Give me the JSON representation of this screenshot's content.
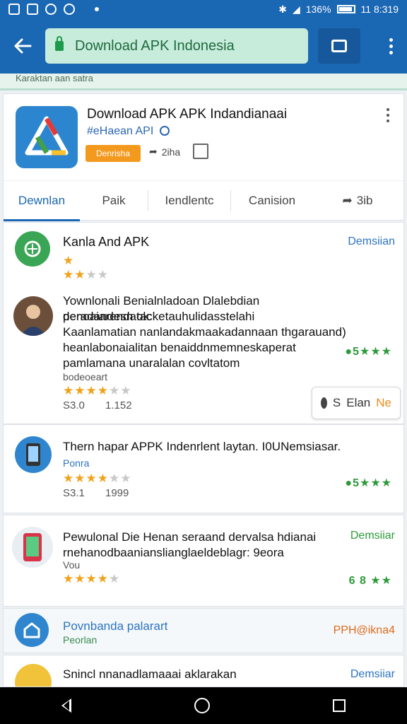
{
  "status_bar": {
    "battery_text": "136%",
    "time": "11 8:319",
    "icons": [
      "image-icon",
      "location-icon",
      "gallery-icon",
      "circle-icon",
      "bluetooth-icon",
      "wifi-off-icon",
      "battery-icon"
    ]
  },
  "toolbar": {
    "url": "Download APK Indonesia",
    "icons": [
      "back-arrow-icon",
      "lock-icon",
      "tabs-icon",
      "kebab-menu-icon"
    ]
  },
  "subline": "Karaktan aan satra",
  "app_header": {
    "title": "Download APK APK Indandianaai",
    "developer": "#eHaean API",
    "badge": "Denrisha",
    "share_count": "2iha",
    "tabs": [
      {
        "label": "Dewnlan",
        "active": true
      },
      {
        "label": "Paik",
        "active": false
      },
      {
        "label": "Iendlentc",
        "active": false
      },
      {
        "label": "Canision",
        "active": false
      },
      {
        "label": "3ib",
        "active": false
      }
    ]
  },
  "items": [
    {
      "title": "Kanla And APK",
      "action": "Demsiian",
      "rating": 2
    },
    {
      "lines": [
        "Yownlonali Benialnladoan Dlalebdian denoaiarendaok:",
        "peradandesn tacketauhulidasstelahi",
        "Kaanlamatian nanlandakmaakadannaan thgarauand)",
        "heanlabonaialitan benaiddnmemneskaperat",
        "pamlamana unaralalan covltatom"
      ],
      "meta": "bodeoeart",
      "rating": 3.5,
      "stat1": "S3.0",
      "stat2": "1.152",
      "green_rating": "5",
      "pill_left": "S",
      "pill_mid": "Elan",
      "pill_right": "Ne"
    },
    {
      "title": "Thern hapar APPK Indenrlent laytan. I0UNemsiasar.",
      "subtitle": "Ponra",
      "rating": 3.5,
      "stat1": "S3.1",
      "stat2": "1999",
      "green_rating": "5"
    },
    {
      "title": "Pewulonal Die Henan seraand dervalsa hdianai",
      "line2": "rnehanodbaanianslianglaeldeblagr: 9eora",
      "line3": "Vou",
      "action": "Demsiiar",
      "rating": 4,
      "green_text": "6 8"
    },
    {
      "title": "Povnbanda palarart",
      "subtitle": "Peorlan",
      "price": "PPH@ikna4"
    },
    {
      "title": "Snincl nnanadlamaaai aklarakan",
      "action": "Demsiiar"
    }
  ],
  "colors": {
    "primary": "#1a67b3",
    "url_bg": "#c8ecdc",
    "star": "#f1a21b",
    "green": "#2d9a3a",
    "badge": "#f39a1e"
  }
}
